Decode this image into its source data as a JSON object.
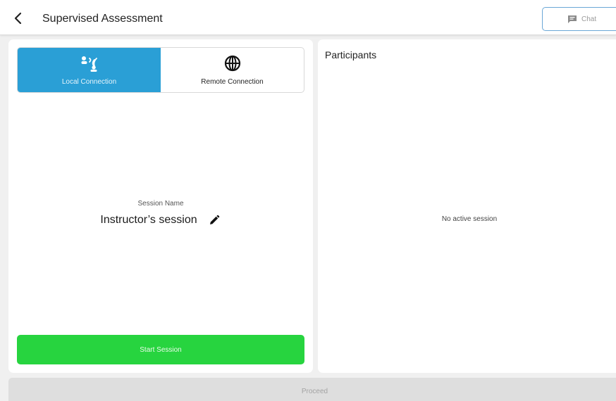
{
  "header": {
    "title": "Supervised Assessment",
    "back_icon": "chevron-left-icon",
    "chat_label": "Chat",
    "chat_icon": "chat-icon"
  },
  "connection_tabs": [
    {
      "label": "Local Connection",
      "icon": "local-connection-icon",
      "active": true
    },
    {
      "label": "Remote Connection",
      "icon": "globe-icon",
      "active": false
    }
  ],
  "session": {
    "label": "Session Name",
    "name": "Instructor’s session",
    "edit_icon": "pencil-icon"
  },
  "start_button_label": "Start Session",
  "participants": {
    "title": "Participants",
    "empty_text": "No active session"
  },
  "proceed_button_label": "Proceed",
  "colors": {
    "accent_blue": "#2a9fd6",
    "start_green": "#27d43f",
    "proceed_gray": "#dedede",
    "chat_border": "#6aa7d6"
  }
}
